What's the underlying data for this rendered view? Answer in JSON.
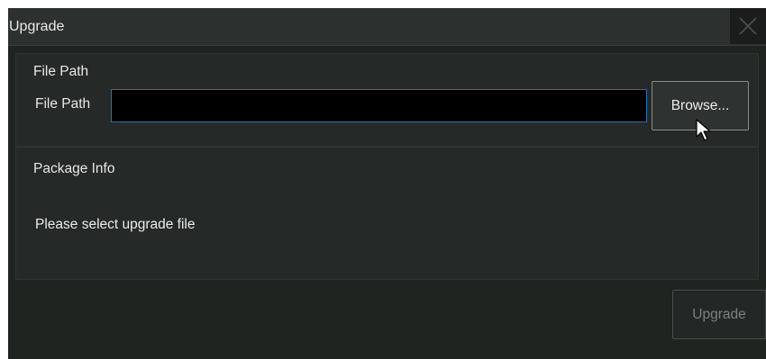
{
  "window": {
    "title": "Upgrade",
    "close_icon": "close-icon"
  },
  "file_section": {
    "title": "File Path",
    "field_label": "File Path",
    "path_value": "",
    "browse_label": "Browse..."
  },
  "info_section": {
    "title": "Package Info",
    "message": "Please select upgrade file"
  },
  "actions": {
    "upgrade_label": "Upgrade",
    "upgrade_enabled": false
  },
  "pointer": {
    "icon": "mouse-pointer-icon"
  },
  "colors": {
    "background": "#202421",
    "titlebar": "#2c302e",
    "input_focus_border": "#2f6fb5",
    "text": "#e8e8e8",
    "disabled_text": "#7d807e"
  }
}
